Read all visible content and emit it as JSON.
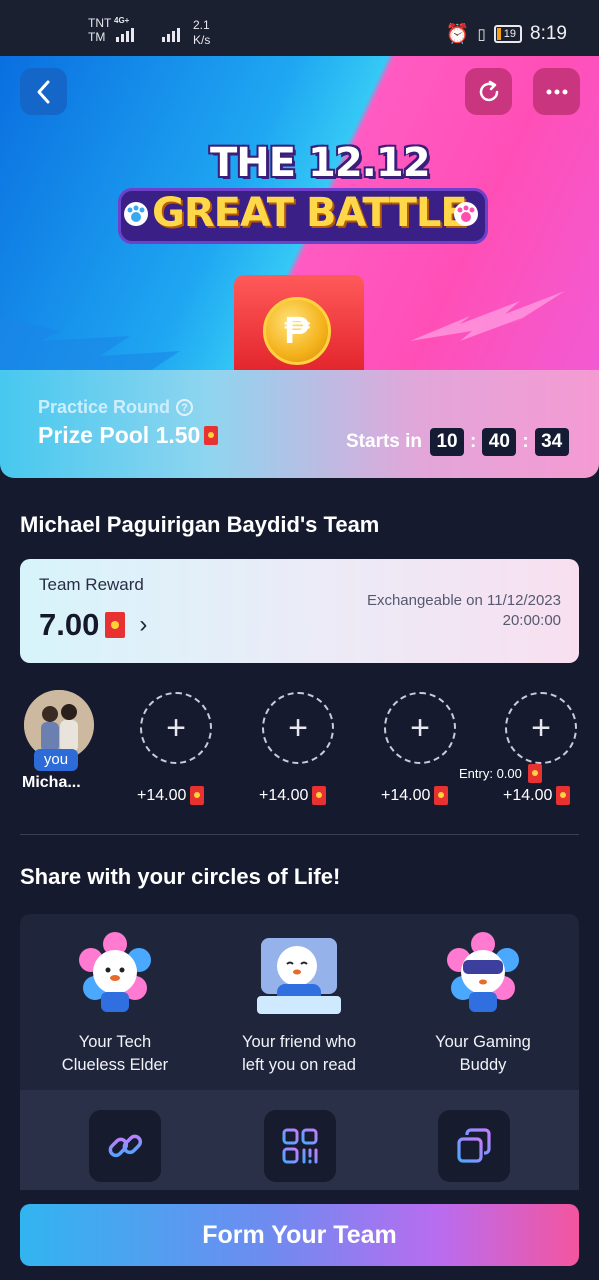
{
  "status_bar": {
    "carrier_top": "TNT",
    "carrier_bottom": "TM",
    "network": "4G+",
    "speed_value": "2.1",
    "speed_unit": "K/s",
    "battery": "19",
    "time": "8:19"
  },
  "hero": {
    "title_line1": "THE 12.12",
    "title_line2": "GREAT BATTLE",
    "back_icon": "chevron-left-icon",
    "refresh_icon": "refresh-icon",
    "more_icon": "more-dots-icon",
    "coin_symbol": "₱"
  },
  "prize": {
    "round_label": "Practice Round",
    "pool_label": "Prize Pool 1.50",
    "entry_label": "Entry: 0.00",
    "starts_label": "Starts in",
    "timer": [
      "10",
      "40",
      "34"
    ]
  },
  "team": {
    "title": "Michael Paguirigan Baydid's Team",
    "reward_label": "Team Reward",
    "reward_amount": "7.00",
    "exchange_line1": "Exchangeable on 11/12/2023",
    "exchange_line2": "20:00:00",
    "you_tag": "you",
    "me_name": "Micha...",
    "slot_reward": "+14.00",
    "slot_plus": "+"
  },
  "share": {
    "title": "Share with your circles of Life!",
    "personas": [
      {
        "line1": "Your Tech",
        "line2": "Clueless Elder"
      },
      {
        "line1": "Your friend who",
        "line2": "left you on read"
      },
      {
        "line1": "Your Gaming",
        "line2": "Buddy"
      }
    ],
    "buttons": [
      "link-icon",
      "qr-code-icon",
      "copy-icon"
    ]
  },
  "cta": {
    "label": "Form Your Team"
  },
  "colors": {
    "background": "#161a2e",
    "accent_blue": "#2d6bd8",
    "accent_pink": "#f4559f",
    "red_packet": "#e83131"
  }
}
